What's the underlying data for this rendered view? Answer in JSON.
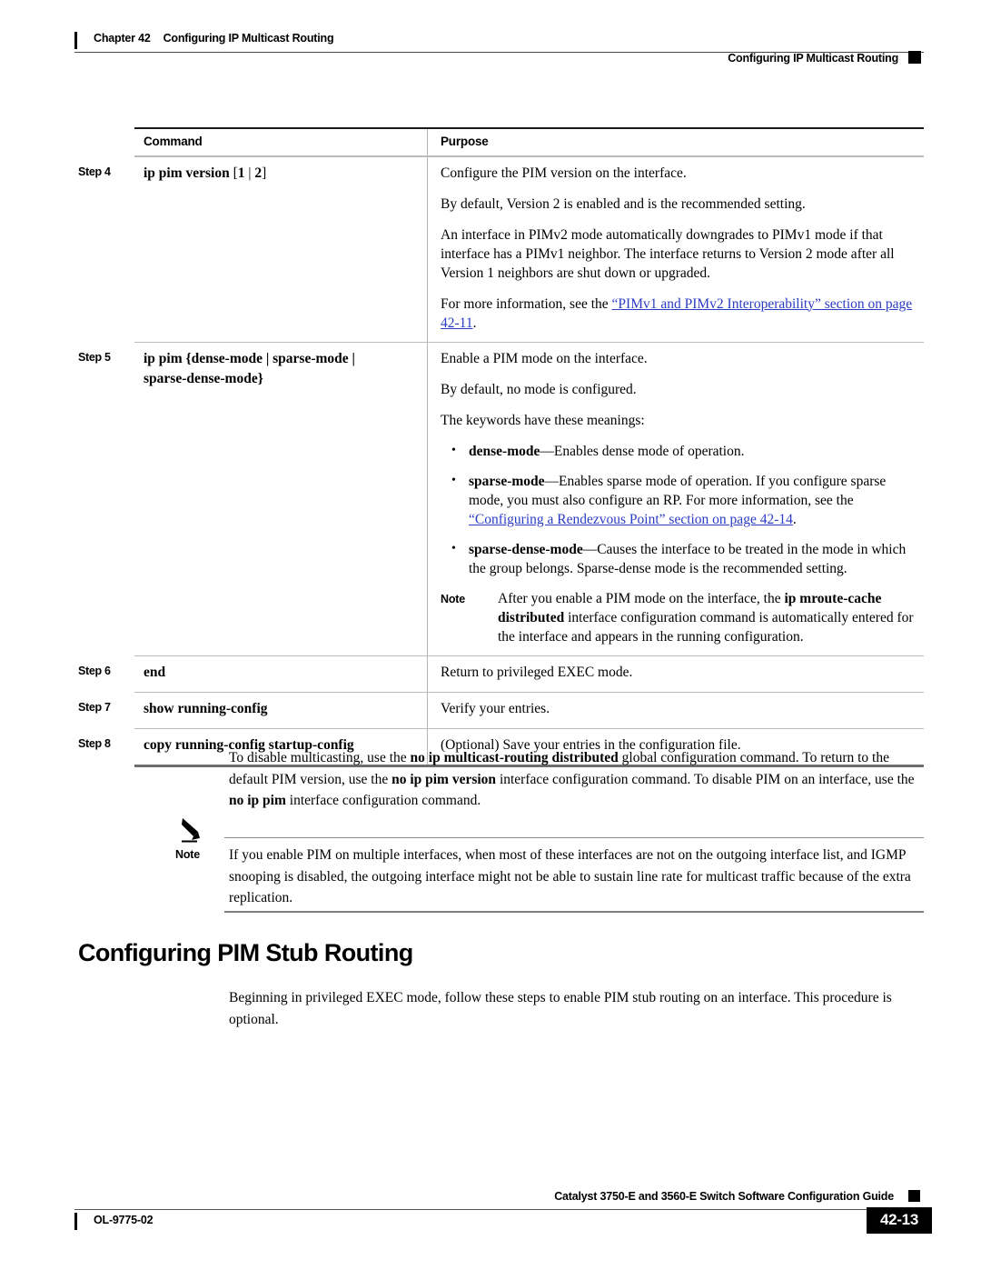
{
  "header": {
    "chapter": "Chapter 42",
    "chapter_title": "Configuring IP Multicast Routing",
    "running_title": "Configuring IP Multicast Routing"
  },
  "table": {
    "columns": {
      "command": "Command",
      "purpose": "Purpose"
    },
    "rows": [
      {
        "step": "Step 4",
        "command_prefix": "ip pim version",
        "command_open": "[",
        "command_opt1": "1",
        "command_sep": "|",
        "command_opt2": "2",
        "command_close": "]",
        "purpose_p1": "Configure the PIM version on the interface.",
        "purpose_p2": "By default, Version 2 is enabled and is the recommended setting.",
        "purpose_p3": "An interface in PIMv2 mode automatically downgrades to PIMv1 mode if that interface has a PIMv1 neighbor. The interface returns to Version 2 mode after all Version 1 neighbors are shut down or upgraded.",
        "purpose_p4_lead": "For more information, see the ",
        "purpose_p4_link": "“PIMv1 and PIMv2 Interoperability” section on page 42-11",
        "purpose_p4_tail": "."
      },
      {
        "step": "Step 5",
        "command_line1": "ip pim {dense-mode | sparse-mode |",
        "command_line2": "sparse-dense-mode}",
        "purpose_p1": "Enable a PIM mode on the interface.",
        "purpose_p2": "By default, no mode is configured.",
        "purpose_p3": "The keywords have these meanings:",
        "bullets": [
          {
            "keyword": "dense-mode",
            "text": "—Enables dense mode of operation."
          },
          {
            "keyword": "sparse-mode",
            "text": "—Enables sparse mode of operation. If you configure sparse mode, you must also configure an RP. For more information, see the ",
            "link": "“Configuring a Rendezvous Point” section on page 42-14",
            "tail": "."
          },
          {
            "keyword": "sparse-dense-mode",
            "text": "—Causes the interface to be treated in the mode in which the group belongs. Sparse-dense mode is the recommended setting."
          }
        ],
        "note_label": "Note",
        "note_lead": "After you enable a PIM mode on the interface, the ",
        "note_command": "ip mroute-cache distributed",
        "note_tail": " interface configuration command is automatically entered for the interface and appears in the running configuration."
      },
      {
        "step": "Step 6",
        "command": "end",
        "purpose": "Return to privileged EXEC mode."
      },
      {
        "step": "Step 7",
        "command": "show running-config",
        "purpose": "Verify your entries."
      },
      {
        "step": "Step 8",
        "command": "copy running-config startup-config",
        "purpose": "(Optional) Save your entries in the configuration file."
      }
    ]
  },
  "body": {
    "para1_a": "To disable multicasting, use the ",
    "para1_cmd1": "no ip multicast-routing distributed",
    "para1_b": " global configuration command. To return to the default PIM version, use the ",
    "para1_cmd2": "no ip pim version",
    "para1_c": " interface configuration command. To disable PIM on an interface, use the ",
    "para1_cmd3": "no ip pim",
    "para1_d": " interface configuration command."
  },
  "callout": {
    "label": "Note",
    "icon": "note-pencil-icon",
    "text": "If you enable PIM on multiple interfaces, when most of these interfaces are not on the outgoing interface list, and IGMP snooping is disabled, the outgoing interface might not be able to sustain line rate for multicast traffic because of the extra replication."
  },
  "section": {
    "heading": "Configuring PIM Stub Routing",
    "para": "Beginning in privileged EXEC mode, follow these steps to enable PIM stub routing on an interface. This procedure is optional."
  },
  "footer": {
    "guide_title": "Catalyst 3750-E and 3560-E Switch Software Configuration Guide",
    "doc_number": "OL-9775-02",
    "page_number": "42-13"
  },
  "colors": {
    "link": "#2b3cc4",
    "rule_dark": "#1a1a1a",
    "rule_light": "#bcbcbc"
  }
}
